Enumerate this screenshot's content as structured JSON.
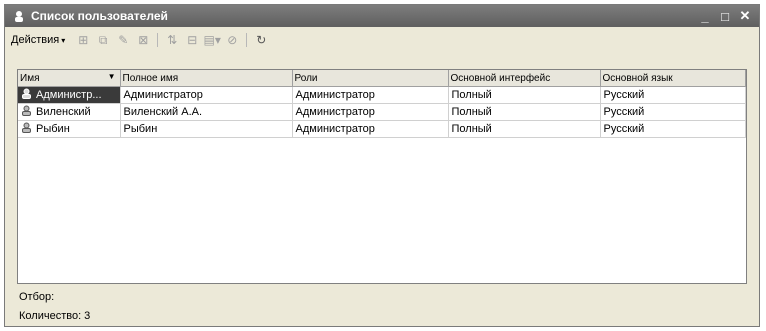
{
  "window": {
    "title": "Список пользователей",
    "controls": {
      "minimize": "_",
      "maximize": "□",
      "close": "✕"
    }
  },
  "toolbar": {
    "actions_label": "Действия",
    "actions_arrow": "▾",
    "buttons": [
      {
        "icon": "add-row-icon",
        "glyph": "⊞"
      },
      {
        "icon": "copy-row-icon",
        "glyph": "⧉"
      },
      {
        "icon": "edit-row-icon",
        "glyph": "✎"
      },
      {
        "icon": "delete-row-icon",
        "glyph": "⊠"
      },
      {
        "icon": "sort-icon",
        "glyph": "⇅"
      },
      {
        "icon": "filter-icon",
        "glyph": "⊟"
      },
      {
        "icon": "filter-settings-icon",
        "glyph": "▤▾"
      },
      {
        "icon": "clear-filter-icon",
        "glyph": "⊘"
      },
      {
        "icon": "refresh-icon",
        "glyph": "↻"
      }
    ]
  },
  "table": {
    "columns": [
      "Имя",
      "Полное имя",
      "Роли",
      "Основной интерфейс",
      "Основной язык"
    ],
    "sort_indicator": "▼",
    "rows": [
      [
        "Администр...",
        "Администратор",
        "Администратор",
        "Полный",
        "Русский"
      ],
      [
        "Виленский",
        "Виленский А.А.",
        "Администратор",
        "Полный",
        "Русский"
      ],
      [
        "Рыбин",
        "Рыбин",
        "Администратор",
        "Полный",
        "Русский"
      ]
    ],
    "selected_row": 0
  },
  "footer": {
    "filter_label": "Отбор:",
    "count_label": "Количество: 3"
  }
}
